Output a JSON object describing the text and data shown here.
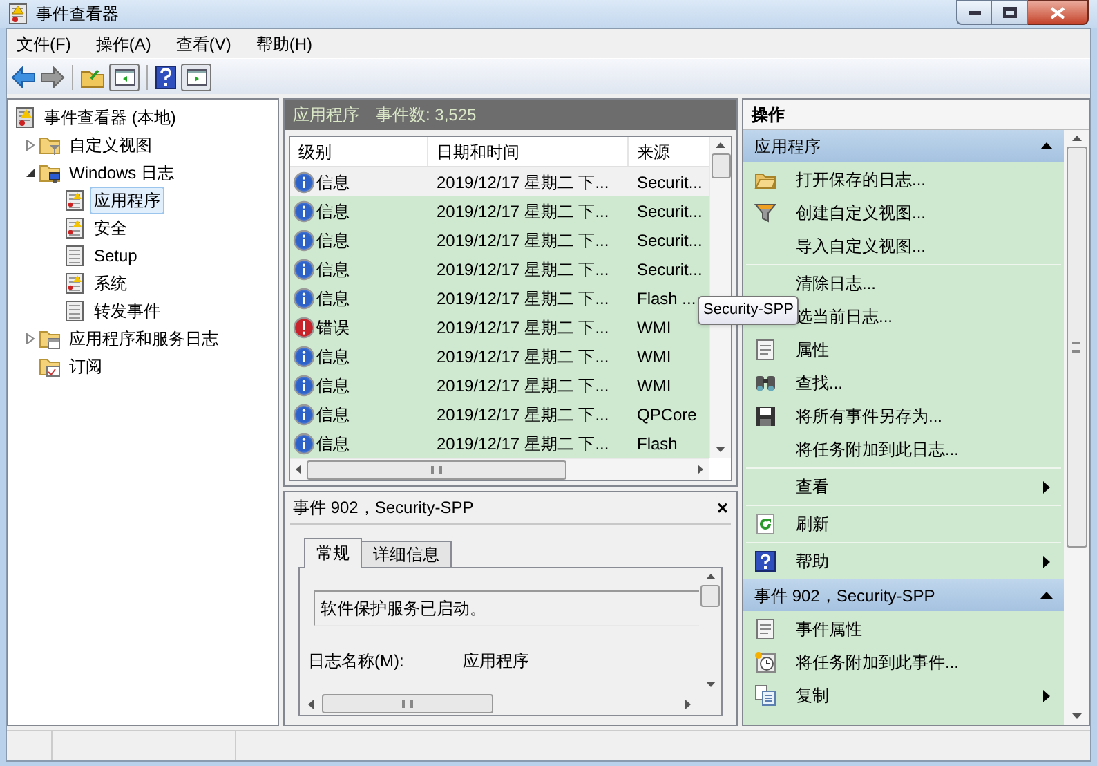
{
  "window": {
    "title": "事件查看器"
  },
  "menu": [
    "文件(F)",
    "操作(A)",
    "查看(V)",
    "帮助(H)"
  ],
  "tree": [
    {
      "label": "事件查看器 (本地)",
      "kind": "viewer",
      "selected": false,
      "children": [
        {
          "label": "自定义视图",
          "kind": "filter-folder",
          "selected": false,
          "expanded": false
        },
        {
          "label": "Windows 日志",
          "kind": "computer-folder",
          "selected": false,
          "expanded": true,
          "children": [
            {
              "label": "应用程序",
              "kind": "log-warn",
              "selected": true
            },
            {
              "label": "安全",
              "kind": "log-warn",
              "selected": false
            },
            {
              "label": "Setup",
              "kind": "log",
              "selected": false
            },
            {
              "label": "系统",
              "kind": "log-warn",
              "selected": false
            },
            {
              "label": "转发事件",
              "kind": "log",
              "selected": false
            }
          ]
        },
        {
          "label": "应用程序和服务日志",
          "kind": "window-folder",
          "selected": false,
          "expanded": false
        },
        {
          "label": "订阅",
          "kind": "calendar-folder",
          "selected": false
        }
      ]
    }
  ],
  "list_header": {
    "title": "应用程序",
    "count": "事件数: 3,525"
  },
  "table": {
    "columns": [
      "级别",
      "日期和时间",
      "来源"
    ],
    "rows": [
      {
        "kind": "info",
        "level": "信息",
        "datetime": "2019/12/17 星期二 下...",
        "source": "Securit...",
        "selected": true
      },
      {
        "kind": "info",
        "level": "信息",
        "datetime": "2019/12/17 星期二 下...",
        "source": "Securit...",
        "selected": false
      },
      {
        "kind": "info",
        "level": "信息",
        "datetime": "2019/12/17 星期二 下...",
        "source": "Securit...",
        "selected": false
      },
      {
        "kind": "info",
        "level": "信息",
        "datetime": "2019/12/17 星期二 下...",
        "source": "Securit...",
        "selected": false
      },
      {
        "kind": "info",
        "level": "信息",
        "datetime": "2019/12/17 星期二 下...",
        "source": "Flash ...",
        "selected": false
      },
      {
        "kind": "error",
        "level": "错误",
        "datetime": "2019/12/17 星期二 下...",
        "source": "WMI",
        "selected": false
      },
      {
        "kind": "info",
        "level": "信息",
        "datetime": "2019/12/17 星期二 下...",
        "source": "WMI",
        "selected": false
      },
      {
        "kind": "info",
        "level": "信息",
        "datetime": "2019/12/17 星期二 下...",
        "source": "WMI",
        "selected": false
      },
      {
        "kind": "info",
        "level": "信息",
        "datetime": "2019/12/17 星期二 下...",
        "source": "QPCore",
        "selected": false
      },
      {
        "kind": "info",
        "level": "信息",
        "datetime": "2019/12/17 星期二 下...",
        "source": "Flash",
        "selected": false
      }
    ]
  },
  "tooltip": "Security-SPP",
  "detail": {
    "title": "事件 902，Security-SPP",
    "close": "×",
    "tabs": [
      {
        "label": "常规",
        "selected": true
      },
      {
        "label": "详细信息",
        "selected": false
      }
    ],
    "message": "软件保护服务已启动。",
    "fields": [
      {
        "label": "日志名称(M):",
        "value": "应用程序"
      }
    ]
  },
  "actions": {
    "title": "操作",
    "sections": [
      {
        "title": "应用程序",
        "groups": [
          [
            {
              "label": "打开保存的日志...",
              "kind": "folder",
              "submenu": false
            },
            {
              "label": "创建自定义视图...",
              "kind": "filter",
              "submenu": false
            },
            {
              "label": "导入自定义视图...",
              "kind": "plain",
              "submenu": false
            }
          ],
          [
            {
              "label": "清除日志...",
              "kind": "plain",
              "submenu": false
            },
            {
              "label": "选当前日志...",
              "kind": "plain",
              "submenu": false
            },
            {
              "label": "属性",
              "kind": "properties",
              "submenu": false
            },
            {
              "label": "查找...",
              "kind": "binoculars",
              "submenu": false
            },
            {
              "label": "将所有事件另存为...",
              "kind": "disk",
              "submenu": false
            },
            {
              "label": "将任务附加到此日志...",
              "kind": "plain",
              "submenu": false
            }
          ],
          [
            {
              "label": "查看",
              "kind": "plain",
              "submenu": true
            }
          ],
          [
            {
              "label": "刷新",
              "kind": "refresh",
              "submenu": false
            }
          ],
          [
            {
              "label": "帮助",
              "kind": "help",
              "submenu": true
            }
          ]
        ]
      },
      {
        "title": "事件 902，Security-SPP",
        "groups": [
          [
            {
              "label": "事件属性",
              "kind": "properties",
              "submenu": false
            },
            {
              "label": "将任务附加到此事件...",
              "kind": "clock",
              "submenu": false
            },
            {
              "label": "复制",
              "kind": "copy",
              "submenu": true
            }
          ]
        ]
      }
    ]
  }
}
